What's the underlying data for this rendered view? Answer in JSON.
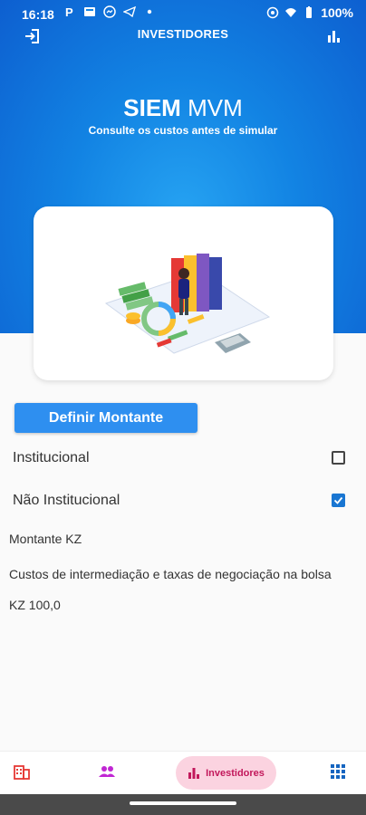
{
  "status_bar": {
    "time": "16:18",
    "battery": "100%"
  },
  "app_bar": {
    "title": "INVESTIDORES"
  },
  "brand": {
    "name_bold": "SIEM",
    "name_light": "MVM",
    "subtitle": "Consulte os custos antes de simular"
  },
  "actions": {
    "define_amount": "Definir Montante"
  },
  "options": [
    {
      "label": "Institucional",
      "checked": false
    },
    {
      "label": "Não Institucional",
      "checked": true
    }
  ],
  "info": {
    "amount_label": "Montante KZ",
    "costs_label": "Custos de intermediação e taxas de negociação na bolsa",
    "costs_value": "KZ 100,0"
  },
  "bottom_nav": {
    "active_label": "Investidores"
  },
  "colors": {
    "primary": "#1283e3",
    "button": "#2e8ff0",
    "accent": "#c2185b",
    "checkbox": "#1976d2"
  }
}
